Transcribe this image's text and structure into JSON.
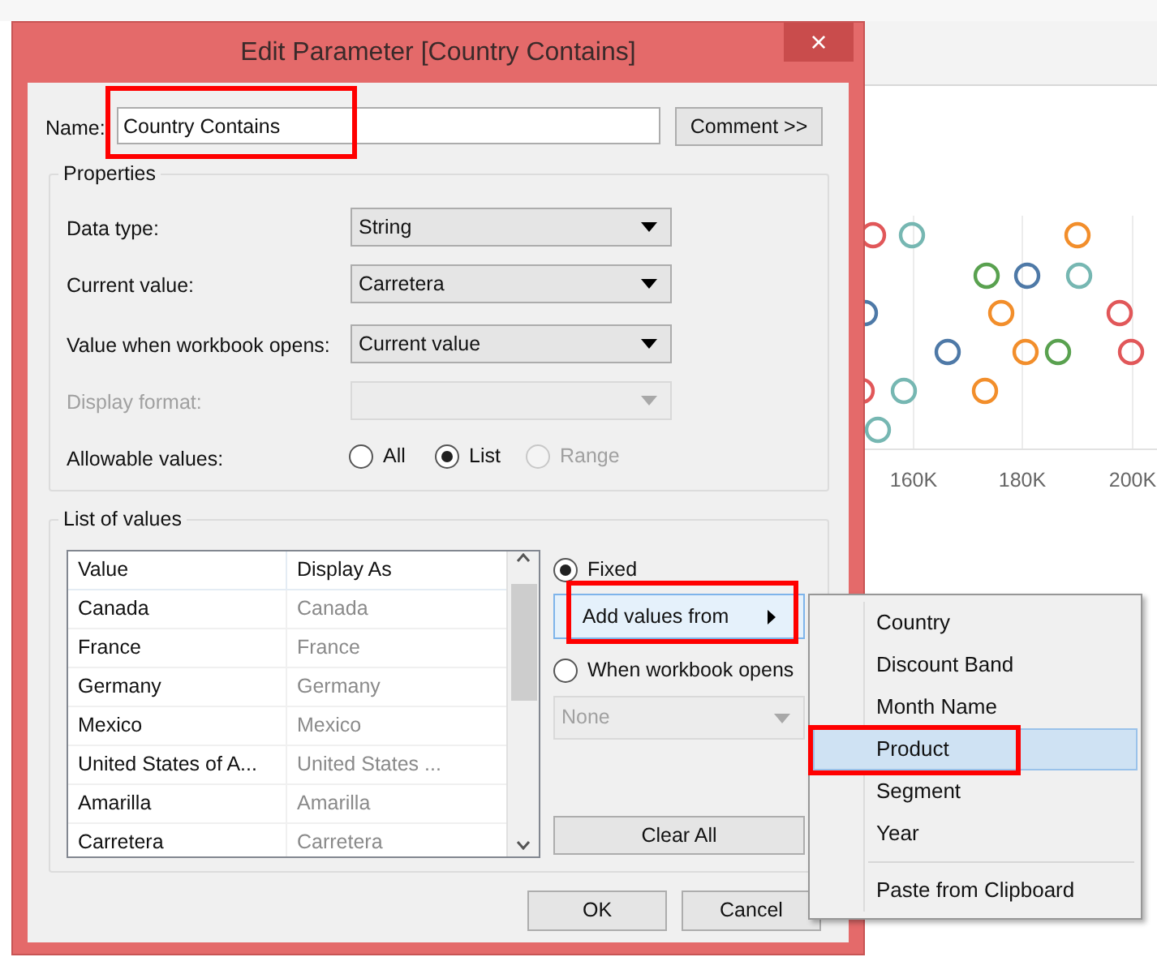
{
  "dialog": {
    "title": "Edit Parameter [Country Contains]",
    "close": "×",
    "name": {
      "label": "Name:",
      "value": "Country Contains",
      "highlight": true
    },
    "comment_button": "Comment >>",
    "properties": {
      "title": "Properties",
      "rows": [
        {
          "label": "Data type:",
          "value": "String",
          "disabled": false
        },
        {
          "label": "Current value:",
          "value": "Carretera",
          "disabled": false
        },
        {
          "label": "Value when workbook opens:",
          "value": "Current value",
          "disabled": false
        },
        {
          "label": "Display format:",
          "value": "",
          "disabled": true
        }
      ],
      "allowable": {
        "label": "Allowable values:",
        "options": [
          {
            "label": "All",
            "selected": false,
            "disabled": false
          },
          {
            "label": "List",
            "selected": true,
            "disabled": false
          },
          {
            "label": "Range",
            "selected": false,
            "disabled": true
          }
        ]
      }
    },
    "list_of_values": {
      "title": "List of values",
      "columns": [
        "Value",
        "Display As"
      ],
      "rows": [
        [
          "Canada",
          "Canada"
        ],
        [
          "France",
          "France"
        ],
        [
          "Germany",
          "Germany"
        ],
        [
          "Mexico",
          "Mexico"
        ],
        [
          "United States of A...",
          "United States ..."
        ],
        [
          "Amarilla",
          "Amarilla"
        ],
        [
          "Carretera",
          "Carretera"
        ]
      ],
      "fixed": {
        "label": "Fixed",
        "selected": true
      },
      "add_values_button": {
        "label": "Add values from",
        "highlight": true
      },
      "when_opens": {
        "label": "When workbook opens",
        "selected": false
      },
      "when_opens_dropdown": {
        "value": "None",
        "disabled": true
      },
      "clear_button": "Clear All"
    },
    "buttons": [
      "OK",
      "Cancel"
    ]
  },
  "menu": {
    "items": [
      {
        "kind": "item",
        "label": "Country",
        "selected": false
      },
      {
        "kind": "item",
        "label": "Discount Band",
        "selected": false
      },
      {
        "kind": "item",
        "label": "Month Name",
        "selected": false
      },
      {
        "kind": "item",
        "label": "Product",
        "selected": true,
        "highlight": true
      },
      {
        "kind": "item",
        "label": "Segment",
        "selected": false
      },
      {
        "kind": "item",
        "label": "Year",
        "selected": false
      },
      {
        "kind": "separator"
      },
      {
        "kind": "item",
        "label": "Paste from Clipboard",
        "selected": false
      }
    ]
  },
  "chart": {
    "x_axis_labels": [
      "160K",
      "180K",
      "200K"
    ]
  }
}
